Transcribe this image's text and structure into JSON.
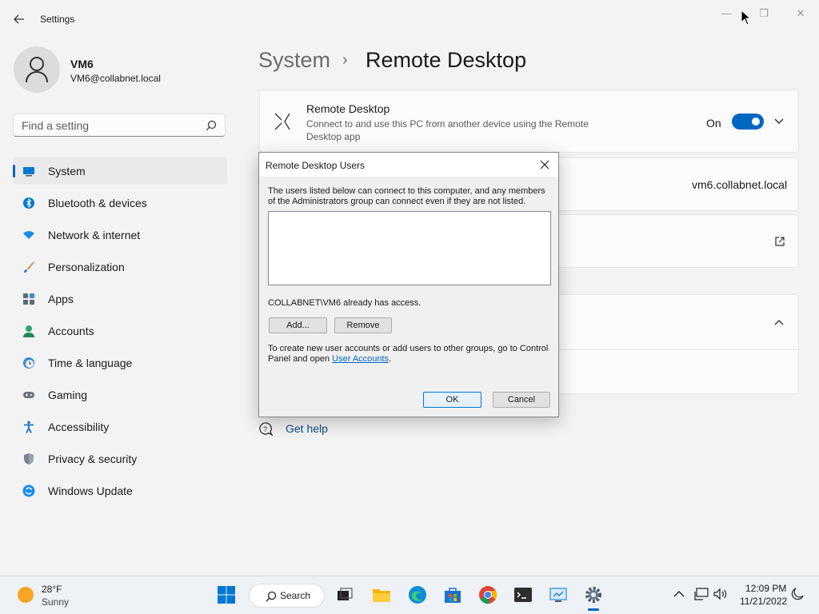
{
  "app": {
    "title": "Settings"
  },
  "profile": {
    "name": "VM6",
    "email": "VM6@collabnet.local"
  },
  "search": {
    "placeholder": "Find a setting"
  },
  "nav": [
    {
      "label": "System",
      "icon": "system-icon",
      "active": true
    },
    {
      "label": "Bluetooth & devices",
      "icon": "bluetooth-icon"
    },
    {
      "label": "Network & internet",
      "icon": "network-icon"
    },
    {
      "label": "Personalization",
      "icon": "brush-icon"
    },
    {
      "label": "Apps",
      "icon": "apps-icon"
    },
    {
      "label": "Accounts",
      "icon": "accounts-icon"
    },
    {
      "label": "Time & language",
      "icon": "clock-icon"
    },
    {
      "label": "Gaming",
      "icon": "gamepad-icon"
    },
    {
      "label": "Accessibility",
      "icon": "accessibility-icon"
    },
    {
      "label": "Privacy & security",
      "icon": "shield-icon"
    },
    {
      "label": "Windows Update",
      "icon": "update-icon"
    }
  ],
  "breadcrumb": {
    "parent": "System",
    "separator": "›",
    "current": "Remote Desktop"
  },
  "remote_desktop": {
    "title": "Remote Desktop",
    "description": "Connect to and use this PC from another device using the Remote Desktop app",
    "state": "On",
    "pc_name": "vm6.collabnet.local"
  },
  "help": {
    "label": "Get help"
  },
  "dialog": {
    "title": "Remote Desktop Users",
    "intro": "The users listed below can connect to this computer, and any members of the Administrators group can connect even if they are not listed.",
    "access": "COLLABNET\\VM6 already has access.",
    "add_label": "Add...",
    "remove_label": "Remove",
    "footer_prefix": "To create new user accounts or add users to other groups, go to Control Panel and open ",
    "footer_link": "User Accounts",
    "footer_suffix": ".",
    "ok_label": "OK",
    "cancel_label": "Cancel"
  },
  "taskbar": {
    "weather_temp": "28°F",
    "weather_desc": "Sunny",
    "search_label": "Search",
    "time": "12:09 PM",
    "date": "11/21/2022"
  },
  "colors": {
    "accent": "#0067c0",
    "background": "#f3f3f3"
  }
}
